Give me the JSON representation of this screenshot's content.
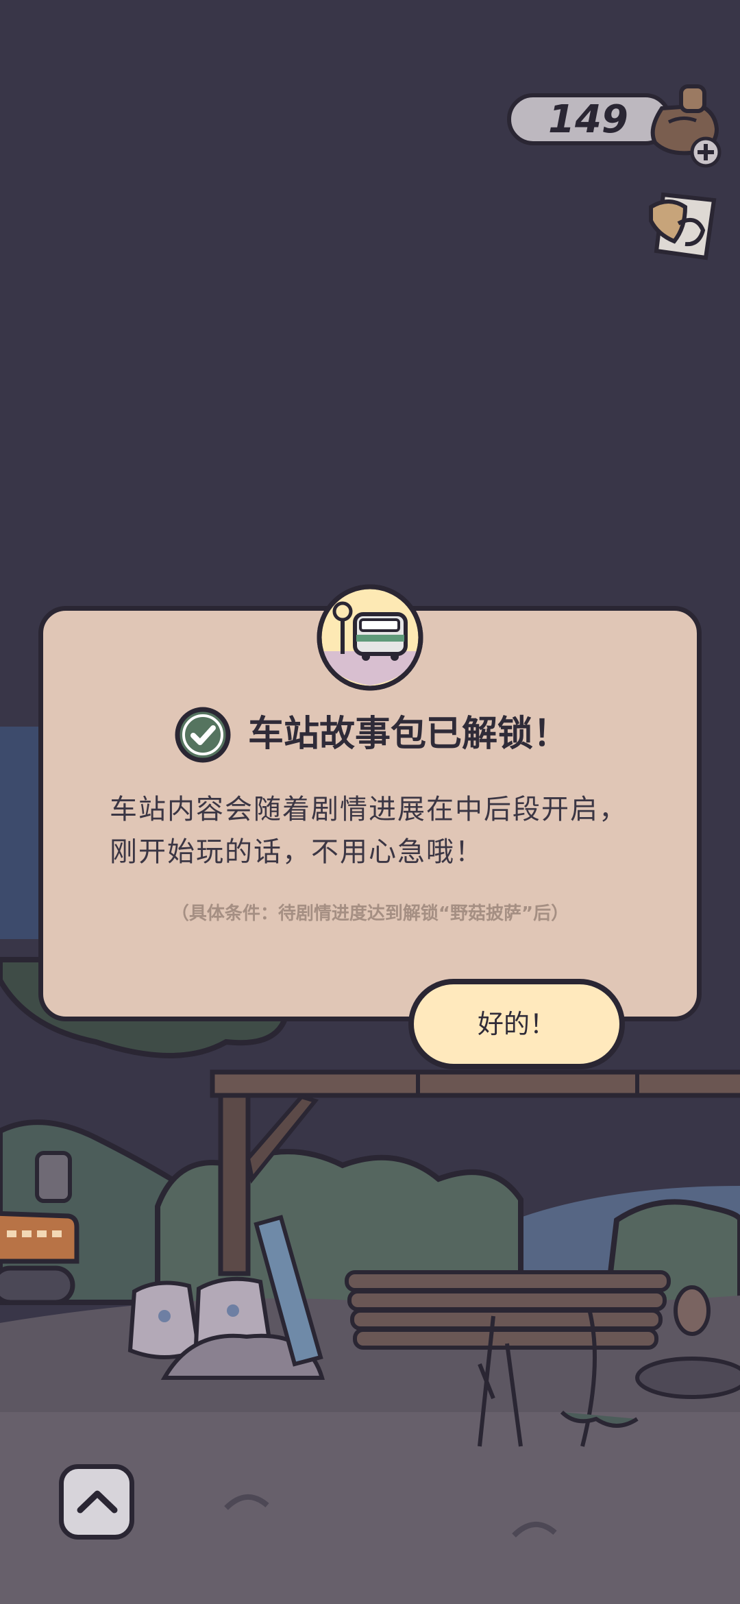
{
  "currency": {
    "amount": "149",
    "icon": "mushroom-icon",
    "add_icon": "plus-icon"
  },
  "sidebar": {
    "card_icon": "story-card-icon"
  },
  "dialog": {
    "badge_icon": "train-icon",
    "status_icon": "check-icon",
    "title": "车站故事包已解锁！",
    "body_lines": [
      "车站内容会随着剧情进展在中后段开启，",
      "刚开始玩的话，不用心急哦！"
    ],
    "note": "（具体条件：待剧情进度达到解锁“野菇披萨”后）",
    "ok_label": "好的！"
  },
  "bottom": {
    "expand_icon": "chevron-up-icon"
  },
  "colors": {
    "night_sky": "#393648",
    "dialog_bg": "#e0c6b6",
    "button_bg": "#ffe9bd",
    "outline": "#2a2633",
    "check_green": "#55745f"
  }
}
